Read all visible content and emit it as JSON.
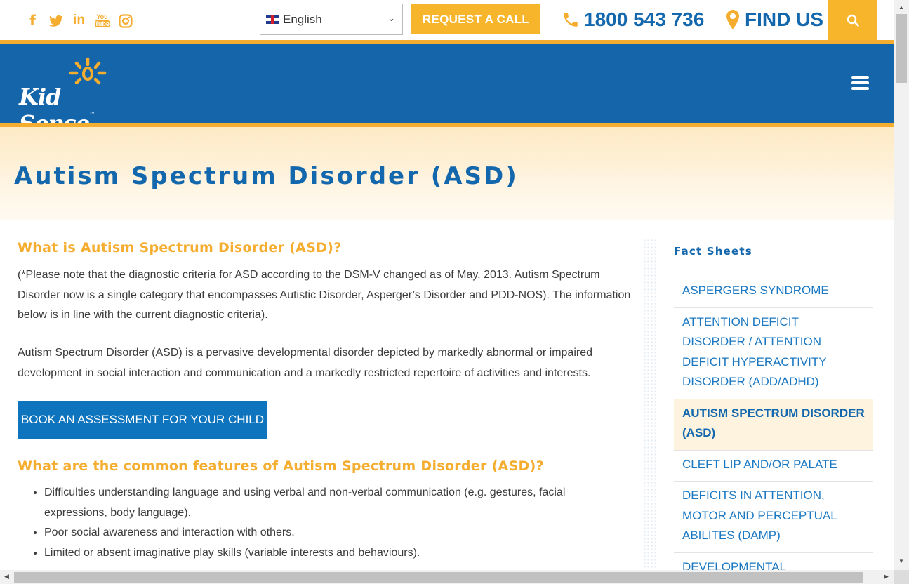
{
  "topbar": {
    "social": {
      "facebook": "f",
      "twitter": "twitter-icon",
      "linkedin": "in",
      "youtube_top": "You",
      "youtube_bottom": "Tube",
      "instagram": "instagram-icon"
    },
    "language": "English",
    "request_call": "REQUEST A CALL",
    "phone": "1800 543 736",
    "find_us": "FIND US"
  },
  "header": {
    "logo_text": "Kid Sense",
    "logo_tm": "™"
  },
  "hero": {
    "title": "Autism Spectrum Disorder (ASD)"
  },
  "main": {
    "h_what": "What is Autism Spectrum Disorder (ASD)?",
    "p1": "(*Please note that the diagnostic criteria for ASD according to the DSM-V changed as of May, 2013. Autism Spectrum Disorder now is a single category that encompasses Autistic Disorder, Asperger’s Disorder and PDD-NOS). The information below is in line with the current diagnostic criteria).",
    "p2": "Autism Spectrum Disorder (ASD) is a pervasive developmental disorder depicted by markedly abnormal or impaired development in social interaction and communication and a markedly restricted repertoire of activities and interests.",
    "book_button": "BOOK AN ASSESSMENT FOR YOUR CHILD",
    "h_features": "What are the common features of Autism Spectrum Disorder (ASD)?",
    "features": [
      "Difficulties understanding language and using verbal and non-verbal communication (e.g. gestures, facial expressions, body language).",
      "Poor social awareness and interaction with others.",
      "Limited or absent imaginative play skills (variable interests and behaviours)."
    ]
  },
  "sidebar": {
    "title": "Fact Sheets",
    "items": [
      "ASPERGERS SYNDROME",
      "ATTENTION DEFICIT DISORDER / ATTENTION DEFICIT HYPERACTIVITY DISORDER (ADD/ADHD)",
      "AUTISM SPECTRUM DISORDER (ASD)",
      "CLEFT LIP AND/OR PALATE",
      "DEFICITS IN ATTENTION, MOTOR AND PERCEPTUAL ABILITES (DAMP)",
      "DEVELOPMENTAL COORDINATION"
    ]
  },
  "colors": {
    "brand_blue": "#1565ab",
    "accent_yellow": "#f7b52c",
    "link_blue": "#1a78c2"
  }
}
